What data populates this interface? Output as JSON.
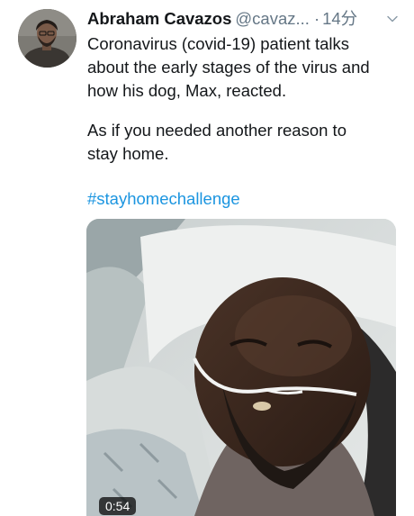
{
  "tweet": {
    "author": {
      "display_name": "Abraham Cavazos",
      "handle": "@cavaz...",
      "avatar_icon": "user-avatar"
    },
    "separator": "·",
    "timestamp": "14分",
    "menu_icon": "chevron-down-icon",
    "text": {
      "paragraph1": "Coronavirus (covid-19) patient talks\nabout the early stages of the virus and\nhow his dog, Max, reacted.",
      "paragraph2": "As if you needed another reason to\nstay home."
    },
    "hashtag": "#stayhomechallenge",
    "video": {
      "duration": "0:54",
      "play_icon": "video-thumbnail"
    }
  },
  "colors": {
    "text": "#14171a",
    "secondary": "#657786",
    "link": "#1b95e0",
    "duration_badge": "#000000"
  }
}
